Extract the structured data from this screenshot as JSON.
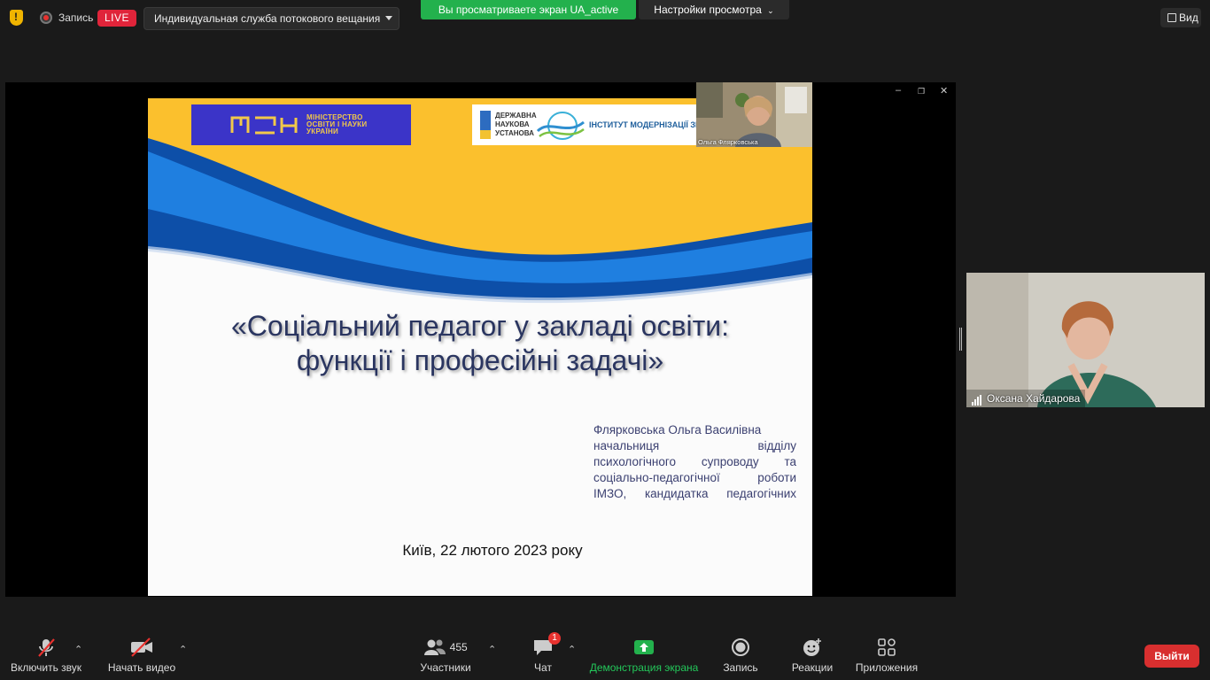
{
  "topbar": {
    "record_label": "Запись",
    "live_label": "LIVE",
    "stream_service": "Индивидуальная служба потокового вещания",
    "viewing_banner": "Вы просматриваете экран UA_active",
    "view_settings": "Настройки просмотра",
    "view_button": "Вид"
  },
  "slide": {
    "ministry_logo_text": [
      "МІНІСТЕРСТВО",
      "ОСВІТИ І НАУКИ",
      "УКРАЇНИ"
    ],
    "dnu_text": [
      "ДЕРЖАВНА",
      "НАУКОВА",
      "УСТАНОВА"
    ],
    "institute_text": "ІНСТИТУТ МОДЕРНІЗАЦІЇ ЗМІСТУ ОСВІТИ",
    "title_line1": "«Соціальний педагог у закладі освіти:",
    "title_line2": "функції і професійні задачі»",
    "author_lines": [
      "Флярковська Ольга Василівна",
      "начальниця відділу",
      "психологічного супроводу та",
      "соціально-педагогічної роботи",
      "ІМЗО, кандидатка педагогічних"
    ],
    "date": "Київ, 22 лютого 2023 року",
    "presenter_pip_name": "Ольга Флярковська"
  },
  "participant": {
    "name": "Оксана Хайдарова"
  },
  "toolbar": {
    "unmute": "Включить звук",
    "start_video": "Начать видео",
    "participants": "Участники",
    "participants_count": "455",
    "chat": "Чат",
    "chat_badge": "1",
    "share_screen": "Демонстрация экрана",
    "record": "Запись",
    "reactions": "Реакции",
    "apps": "Приложения",
    "leave": "Выйти"
  },
  "colors": {
    "live": "#e0243a",
    "viewing_banner": "#23b14d",
    "share_icon": "#23b14d",
    "leave": "#d82f2f",
    "slide_yellow": "#fbc02d",
    "slide_blue": "#1a6fd1"
  }
}
